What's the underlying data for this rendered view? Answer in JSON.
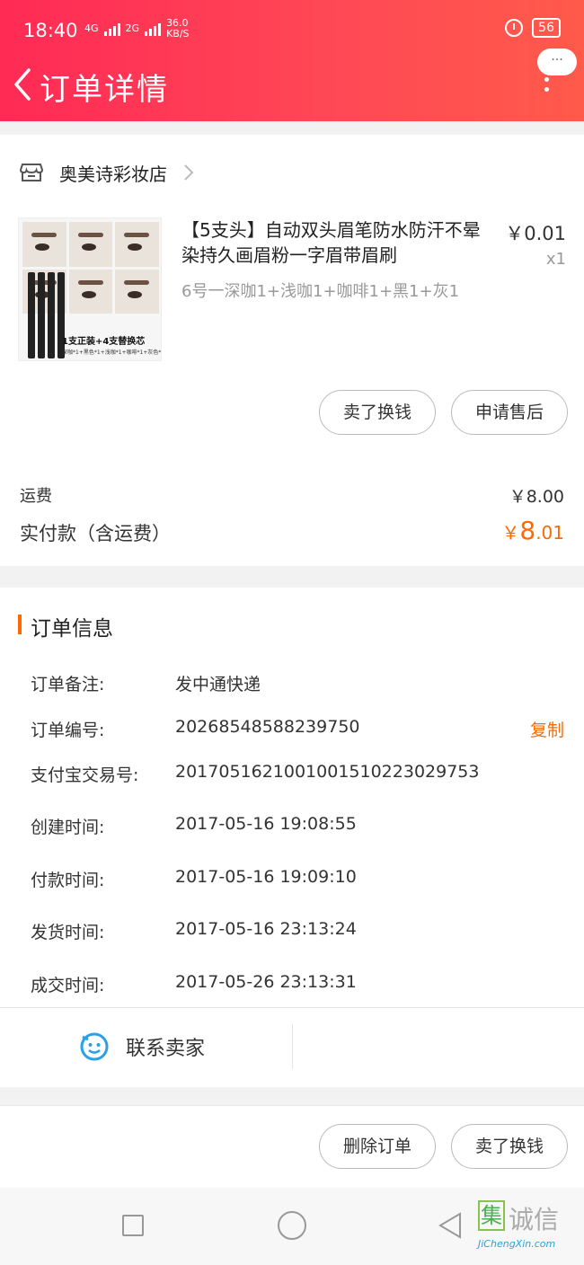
{
  "status_bar": {
    "time": "18:40",
    "network_4g": "4G",
    "network_2g": "2G",
    "speed": "36.0",
    "speed_unit": "KB/S",
    "battery": "56"
  },
  "nav": {
    "title": "订单详情",
    "more_bubble": "···"
  },
  "shop": {
    "name": "奥美诗彩妆店"
  },
  "product": {
    "title": "【5支头】自动双头眉笔防水防汗不晕染持久画眉粉一字眉带眉刷",
    "price": "￥0.01",
    "quantity": "x1",
    "spec": "6号一深咖1+浅咖1+咖啡1+黑1+灰1",
    "image_caption": "1支正装+4支替换芯",
    "image_sub": "深咖*1+黑色*1+浅咖*1+咖啡*1+灰色*1"
  },
  "product_actions": {
    "sell_label": "卖了换钱",
    "aftersale_label": "申请售后"
  },
  "summary": {
    "freight_label": "运费",
    "freight_value": "￥8.00",
    "paid_label": "实付款（含运费）",
    "paid_currency": "￥",
    "paid_integer": "8",
    "paid_decimal": ".01"
  },
  "order_info": {
    "title": "订单信息",
    "rows": [
      {
        "label": "订单备注:",
        "value": "发中通快递"
      },
      {
        "label": "订单编号:",
        "value": "20268548588239750"
      },
      {
        "label": "支付宝交易号:",
        "value": "2017051621001001510223029753"
      },
      {
        "label": "创建时间:",
        "value": "2017-05-16 19:08:55"
      },
      {
        "label": "付款时间:",
        "value": "2017-05-16 19:09:10"
      },
      {
        "label": "发货时间:",
        "value": "2017-05-16 23:13:24"
      },
      {
        "label": "成交时间:",
        "value": "2017-05-26 23:13:31"
      }
    ],
    "copy_label": "复制",
    "contact_label": "联系卖家"
  },
  "bottom_actions": {
    "delete_label": "删除订单",
    "sell_label": "卖了换钱"
  },
  "watermark": {
    "mark": "集",
    "text": "诚信",
    "url": "JiChengXin.com"
  },
  "colors": {
    "header_gradient_start": "#ff2a55",
    "header_gradient_end": "#ff5a4a",
    "accent_orange": "#ff6a00"
  }
}
